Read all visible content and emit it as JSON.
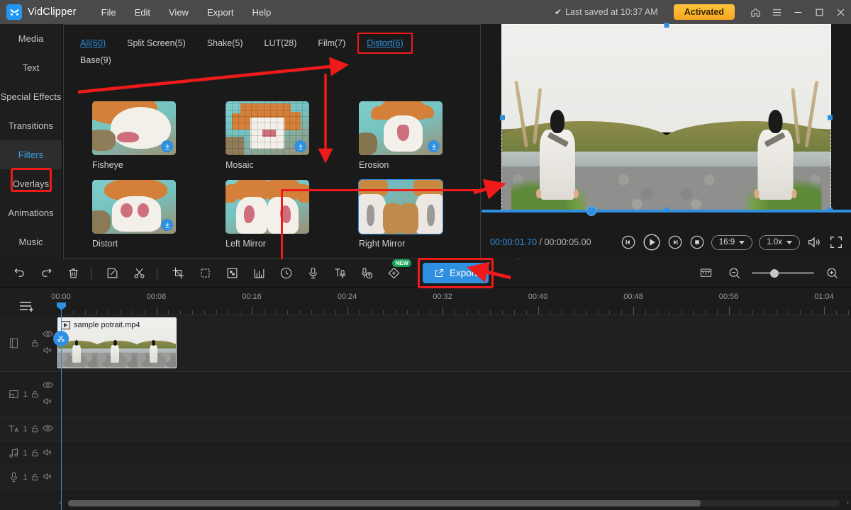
{
  "titlebar": {
    "app_name": "VidClipper",
    "menus": [
      "File",
      "Edit",
      "View",
      "Export",
      "Help"
    ],
    "saved_text": "Last saved at 10:37 AM",
    "saved_check": "✔",
    "activated_label": "Activated",
    "window_buttons": [
      "home-icon",
      "menu-icon",
      "minimize-icon",
      "maximize-icon",
      "close-icon"
    ],
    "accent": "#2f8fe0",
    "activated_color": "#f5a623"
  },
  "sidebar": {
    "items": [
      {
        "label": "Media",
        "active": false
      },
      {
        "label": "Text",
        "active": false
      },
      {
        "label": "Special Effects",
        "active": false
      },
      {
        "label": "Transitions",
        "active": false
      },
      {
        "label": "Filters",
        "active": true
      },
      {
        "label": "Overlays",
        "active": false
      },
      {
        "label": "Animations",
        "active": false
      },
      {
        "label": "Music",
        "active": false
      }
    ],
    "highlighted_item": "Filters"
  },
  "filters_panel": {
    "tabs": [
      {
        "label": "All(60)",
        "state": "selected"
      },
      {
        "label": "Split Screen(5)",
        "state": "normal"
      },
      {
        "label": "Shake(5)",
        "state": "normal"
      },
      {
        "label": "LUT(28)",
        "state": "normal"
      },
      {
        "label": "Film(7)",
        "state": "normal"
      },
      {
        "label": "Distort(6)",
        "state": "highlighted"
      },
      {
        "label": "Base(9)",
        "state": "normal"
      }
    ],
    "items": [
      {
        "label": "Fisheye",
        "downloadable": true,
        "selected": false
      },
      {
        "label": "Mosaic",
        "downloadable": true,
        "selected": false
      },
      {
        "label": "Erosion",
        "downloadable": true,
        "selected": false
      },
      {
        "label": "Distort",
        "downloadable": true,
        "selected": false
      },
      {
        "label": "Left Mirror",
        "downloadable": false,
        "selected": false
      },
      {
        "label": "Right Mirror",
        "downloadable": false,
        "selected": true
      }
    ]
  },
  "preview": {
    "current_time": "00:00:01.70",
    "separator": "/",
    "total_time": "00:00:05.00",
    "aspect_ratio": "16:9",
    "playback_speed": "1.0x",
    "controls": [
      "prev-frame-icon",
      "play-icon",
      "next-frame-icon",
      "stop-icon",
      "aspect-ratio-select",
      "speed-select",
      "volume-icon",
      "fullscreen-icon"
    ]
  },
  "toolbar": {
    "tools": [
      {
        "name": "undo-icon"
      },
      {
        "name": "redo-icon"
      },
      {
        "name": "delete-icon"
      },
      {
        "name": "edit-icon"
      },
      {
        "name": "split-icon"
      },
      {
        "name": "crop-icon"
      },
      {
        "name": "mask-icon"
      },
      {
        "name": "chroma-key-icon"
      },
      {
        "name": "audio-mixer-icon"
      },
      {
        "name": "speed-icon"
      },
      {
        "name": "record-voiceover-icon"
      },
      {
        "name": "text-to-speech-icon"
      },
      {
        "name": "speech-to-text-icon"
      },
      {
        "name": "ai-effects-icon",
        "badge": "NEW"
      }
    ],
    "export_label": "Export",
    "export_color": "#2f8fe0",
    "zoom_controls": [
      "fit-to-screen-icon",
      "zoom-out-icon",
      "zoom-slider",
      "zoom-in-icon"
    ]
  },
  "timeline": {
    "ruler_labels": [
      "00:00",
      "00:08",
      "00:16",
      "00:24",
      "00:32",
      "00:40",
      "00:48",
      "00:56",
      "01:04"
    ],
    "playhead_time": "00:00",
    "tracks": [
      {
        "type": "video",
        "icon": "film-icon",
        "count": "",
        "lock": "unlock-icon",
        "eye": "eye-icon",
        "audio": "volume-icon"
      },
      {
        "type": "overlay",
        "icon": "pip-icon",
        "count": "1",
        "lock": "unlock-icon",
        "eye": "eye-icon",
        "audio": "volume-icon"
      },
      {
        "type": "text",
        "icon": "text-icon",
        "count": "1",
        "lock": "unlock-icon",
        "eye": "eye-icon",
        "audio": ""
      },
      {
        "type": "music",
        "icon": "music-note-icon",
        "count": "1",
        "lock": "unlock-icon",
        "eye": "",
        "audio": "volume-icon"
      },
      {
        "type": "voiceover",
        "icon": "microphone-icon",
        "count": "1",
        "lock": "unlock-icon",
        "eye": "",
        "audio": "volume-icon"
      }
    ],
    "clips": [
      {
        "name": "sample potrait.mp4",
        "track": "video"
      }
    ],
    "add_track_icon": "add-track-icon"
  },
  "annotations": {
    "color": "#ef1a1a",
    "boxes": [
      "filters-nav-item",
      "distort-tab",
      "mirror-filters-group",
      "export-button"
    ],
    "arrows": [
      "arrow-to-distort-tab",
      "arrow-down-to-mirror-row",
      "arrow-to-preview",
      "arrow-to-export-button"
    ]
  }
}
